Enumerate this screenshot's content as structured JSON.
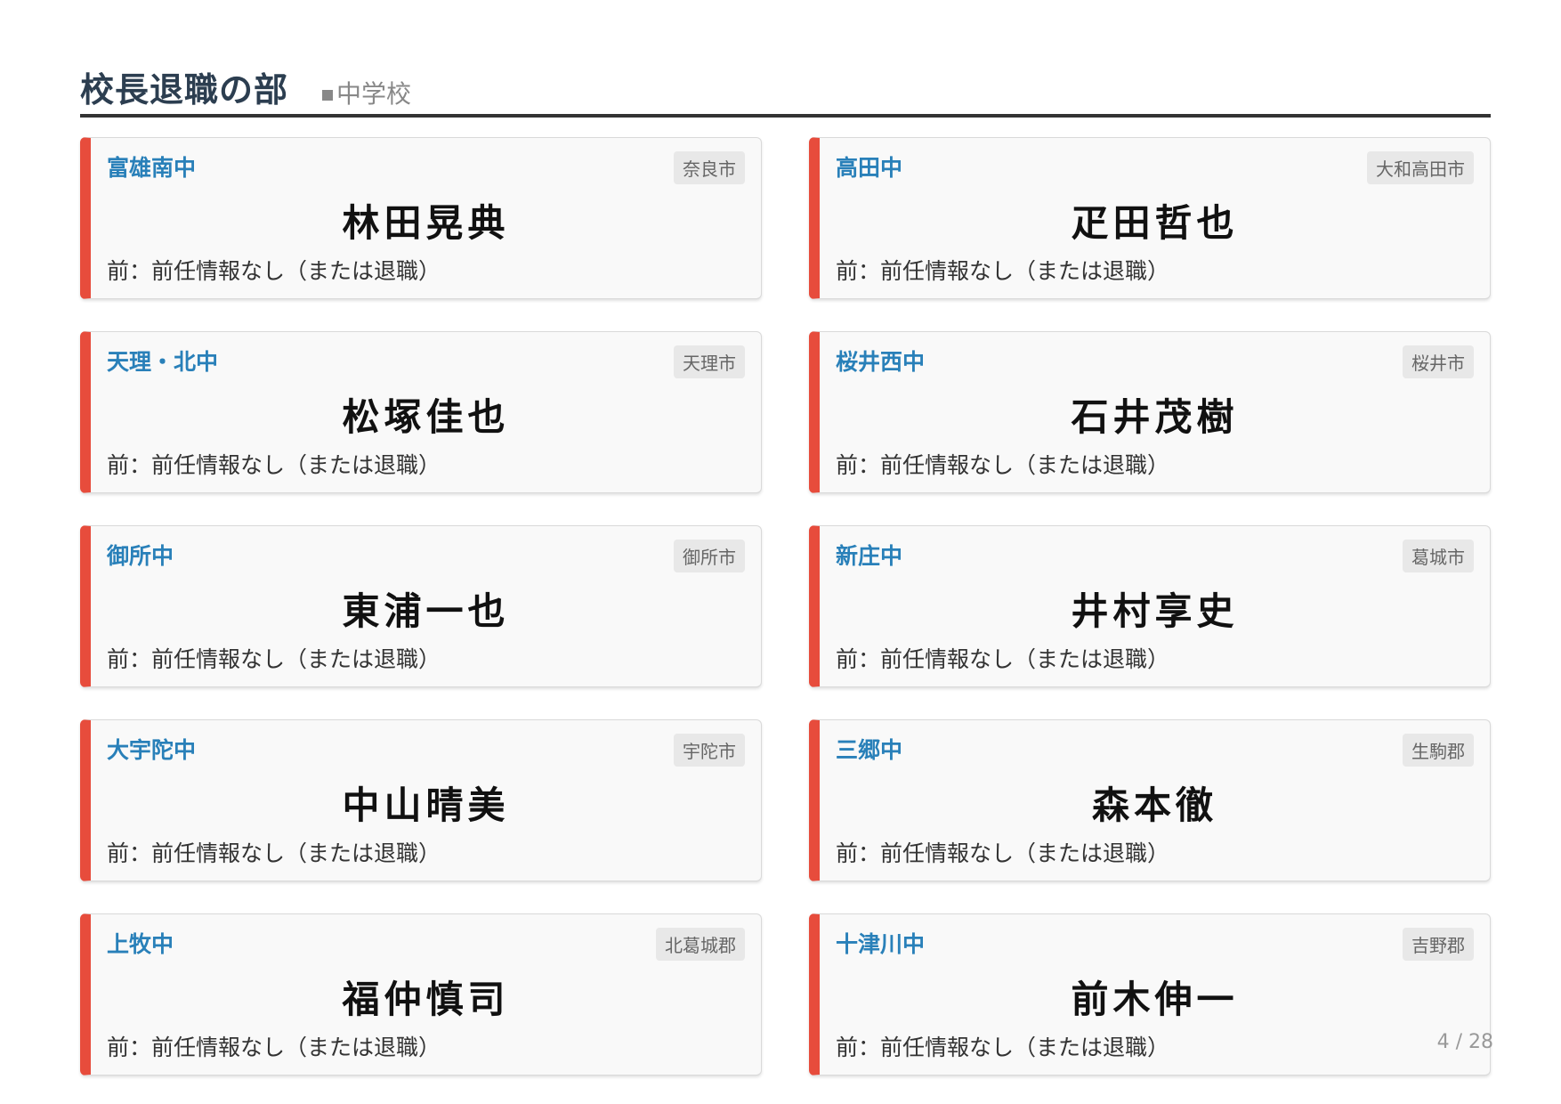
{
  "header": {
    "title": "校長退職の部",
    "subtitle": "中学校",
    "subtitle_icon": "square-icon"
  },
  "cards": [
    {
      "school": "富雄南中",
      "area": "奈良市",
      "name": "林田晃典",
      "previous": "前：前任情報なし（または退職）"
    },
    {
      "school": "高田中",
      "area": "大和高田市",
      "name": "疋田哲也",
      "previous": "前：前任情報なし（または退職）"
    },
    {
      "school": "天理・北中",
      "area": "天理市",
      "name": "松塚佳也",
      "previous": "前：前任情報なし（または退職）"
    },
    {
      "school": "桜井西中",
      "area": "桜井市",
      "name": "石井茂樹",
      "previous": "前：前任情報なし（または退職）"
    },
    {
      "school": "御所中",
      "area": "御所市",
      "name": "東浦一也",
      "previous": "前：前任情報なし（または退職）"
    },
    {
      "school": "新庄中",
      "area": "葛城市",
      "name": "井村享史",
      "previous": "前：前任情報なし（または退職）"
    },
    {
      "school": "大宇陀中",
      "area": "宇陀市",
      "name": "中山晴美",
      "previous": "前：前任情報なし（または退職）"
    },
    {
      "school": "三郷中",
      "area": "生駒郡",
      "name": "森本徹",
      "previous": "前：前任情報なし（または退職）"
    },
    {
      "school": "上牧中",
      "area": "北葛城郡",
      "name": "福仲慎司",
      "previous": "前：前任情報なし（または退職）"
    },
    {
      "school": "十津川中",
      "area": "吉野郡",
      "name": "前木伸一",
      "previous": "前：前任情報なし（または退職）"
    }
  ],
  "footer": {
    "page_number": "4 / 28"
  },
  "colors": {
    "accent_bar": "#e74c3c",
    "school_name": "#2980b9",
    "title": "#2c3e50"
  }
}
